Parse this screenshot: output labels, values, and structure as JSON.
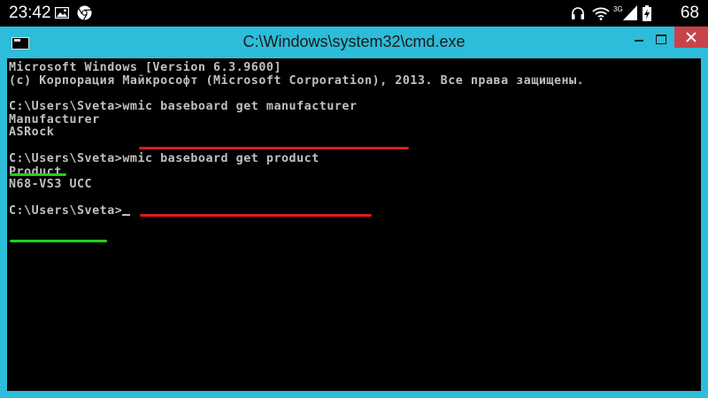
{
  "status_bar": {
    "time": "23:42",
    "network": "3G",
    "battery": "68",
    "icons": [
      "gallery-icon",
      "chrome-icon",
      "headset-icon",
      "wifi-icon",
      "signal-icon",
      "battery-icon"
    ]
  },
  "window": {
    "title": "C:\\Windows\\system32\\cmd.exe",
    "icon": "console-icon",
    "accent_color": "#2dbcd9",
    "close_color": "#c7434a"
  },
  "console": {
    "lines": [
      "Microsoft Windows [Version 6.3.9600]",
      "(c) Корпорация Майкрософт (Microsoft Corporation), 2013. Все права защищены.",
      "",
      "C:\\Users\\Sveta>wmic baseboard get manufacturer",
      "Manufacturer",
      "ASRock",
      "",
      "C:\\Users\\Sveta>wmic baseboard get product",
      "Product",
      "N68-VS3 UCC",
      "",
      "C:\\Users\\Sveta>"
    ],
    "text_color": "#c0c0c0",
    "annotation_colors": {
      "command": "#e2181c",
      "result": "#22d11a"
    }
  }
}
